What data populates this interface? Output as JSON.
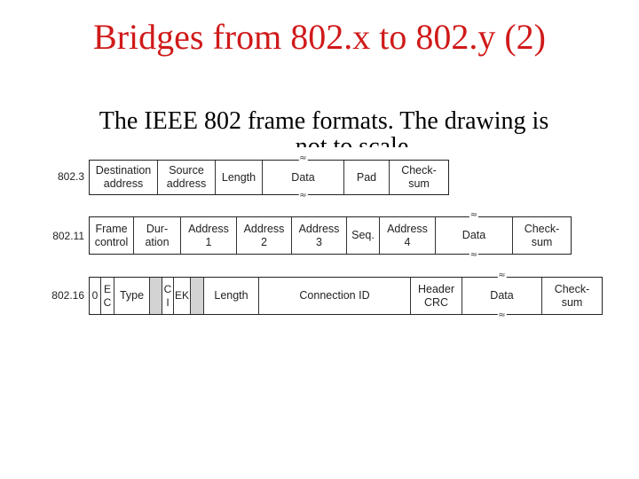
{
  "slide": {
    "title": "Bridges from 802.x to 802.y (2)",
    "subtitle": "The IEEE 802 frame formats.  The drawing is",
    "subtitle_clipped": "not to scale."
  },
  "colors": {
    "title": "#d01a1a",
    "text": "#000000",
    "reserved_field": "#d3d3d3"
  },
  "break_symbol": "≈",
  "frames": [
    {
      "name": "802.3",
      "fields": [
        {
          "label": "Destination\naddress"
        },
        {
          "label": "Source\naddress"
        },
        {
          "label": "Length"
        },
        {
          "label": "Data",
          "variable_length": true
        },
        {
          "label": "Pad"
        },
        {
          "label": "Check-\nsum"
        }
      ]
    },
    {
      "name": "802.11",
      "fields": [
        {
          "label": "Frame\ncontrol"
        },
        {
          "label": "Dur-\nation"
        },
        {
          "label": "Address\n1"
        },
        {
          "label": "Address\n2"
        },
        {
          "label": "Address\n3"
        },
        {
          "label": "Seq."
        },
        {
          "label": "Address\n4"
        },
        {
          "label": "Data",
          "variable_length": true
        },
        {
          "label": "Check-\nsum"
        }
      ]
    },
    {
      "name": "802.16",
      "fields": [
        {
          "label": "0"
        },
        {
          "label": "E\nC"
        },
        {
          "label": "Type"
        },
        {
          "label": "",
          "reserved": true
        },
        {
          "label": "C\nI"
        },
        {
          "label": "EK"
        },
        {
          "label": "",
          "reserved": true
        },
        {
          "label": "Length"
        },
        {
          "label": "Connection ID"
        },
        {
          "label": "Header\nCRC"
        },
        {
          "label": "Data",
          "variable_length": true
        },
        {
          "label": "Check-\nsum"
        }
      ]
    }
  ]
}
